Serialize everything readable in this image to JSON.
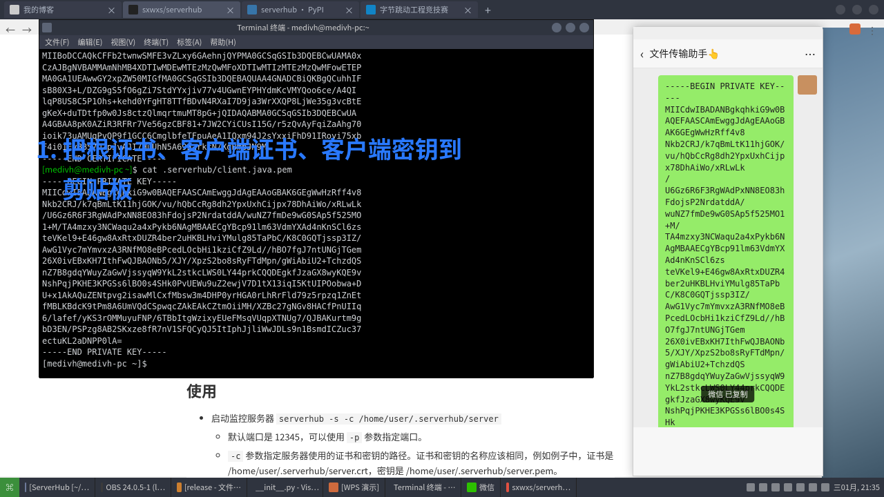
{
  "browser": {
    "tabs": [
      {
        "title": "我的博客"
      },
      {
        "title": "sxwxs/serverhub"
      },
      {
        "title": "serverhub · PyPI"
      },
      {
        "title": "字节跳动工程竞技赛"
      }
    ],
    "new_tab_label": "+"
  },
  "terminal": {
    "title": "Terminal 终端 - medivh@medivh-pc:~",
    "menus": [
      "文件(F)",
      "编辑(E)",
      "视图(V)",
      "终端(T)",
      "标签(A)",
      "帮助(H)"
    ],
    "lines": [
      "MIIBoDCCAQkCFFb2twnwSMFE3vZLxy6GAehnjQYPMA0GCSqGSIb3DQEBCwUAMA0x",
      "CzAJBgNVBAMMAmNhMB4XDTIwMDEwMTEzMzQwMFoXDTIwMTIzMTEzMzQwMFowETEP",
      "MA0GA1UEAwwGY2xpZW50MIGfMA0GCSqGSIb3DQEBAQUAA4GNADCBiQKBgQCuhhIF",
      "sB80X3+L/DZG9gS5fO6gZi7StdYYxjiv77v4UGwnEYPHYdmKcVMYQoo6ce/A4QI",
      "lqP8US8C5P1Ohs+kehd0YFgHT8TTfBDvN4RXaI7D9ja3WrXXQP8LjWe35g3vcBtE",
      "gKeX+duTDtfp0w0Js8ctzQlmqrtmuMT8pG+jQIDAQABMA0GCSqGSIb3DQEBCwUA",
      "A4GBAA8pK0AZiR3RFRr7Ve56gzCBF81+7JW2CYiCUsI15G/r5zQvAyFqiZaAhg70",
      "ioik73uAMUqPvQP9f1GCC6CmglbfeTFpuAeA1IQxm94J2sYxxiFhD91IRoyi75xb",
      "F4i01EvBB57UZpJvAJI7HuUhN5A695arkfN/XgBmbJN9M",
      "-----END CERTIFICATE-----",
      "[medivh@medivh-pc ~]$ cat .serverhub/client.java.pem",
      "-----BEGIN PRIVATE KEY-----",
      "MIICdwIBADANBgkqhkiG9w0BAQEFAASCAmEwggJdAgEAAoGBAK6GEgWwHzRff4v8",
      "Nkb2CRJ/k7qBmLtK11hjGOK/vu/hQbCcRg8dh2YpxUxhCijpx78DhAiWo/xRLwLk",
      "/U6Gz6R6F3RgWAdPxNN8EO83hFdojsP2NrdatddA/wuNZ7fmDe9wG0SAp5f525MO",
      "1+M/TA4mzxy3NCWaqu2a4xPykb6NAgMBAAECgYBcp91lm63VdmYXAd4nKnSCl6zs",
      "teVKel9+E46gw8AxRtxDUZR4ber2uHKBLHviYMulg85TaPbC/K8C0GQTjssp3IZ/",
      "AwG1Vyc7mYmvxzA3RNfMO8eBPcedLOcbHi1kziCfZ9Ld//hBO7fgJ7ntUNGjTGem",
      "26X0ivEBxKH7IthFwQJBAONb5/XJY/XpzS2bo8sRyFTdMpn/gWiAbiU2+TchzdQS",
      "nZ7B8gdqYWuyZaGwVjssyqW9YkL2stkcLWS0LY44prkCQQDEgkfJzaGX8wyKQE9v",
      "NshPqjPKHE3KPGSs6lBO0s4SHk0PvUEWu9uZ2ewjV7D1tX13iqI5KtUIPOobwa+D",
      "U+x1AkAQuZENtpvg2isawMlCxfMbsw3m4DHP0yrHGA0rLhRrFld79z5rpzq1ZnEt",
      "fMBLKBdcK9tPm8A6UmVQdCSpwqcZAkEAkCZtmOiiMH/XZBc27gNGv8HACfPnUIIq",
      "6/lafef/yKS3rOMMuyuFNP/6TBbItgWzixyEUeFMsqVUqpXTNUg7/QJBAKurtm9g",
      "bD3EN/PSPzg8AB2SKxze8fR7nV1SFQCyQJ5ItIphJjliWwJDLs9n1BsmdICZuc37",
      "ectuKL2aDNPP0lA=",
      "-----END PRIVATE KEY-----",
      "[medivh@medivh-pc ~]$ "
    ],
    "prompt_index_1": 10,
    "prompt_index_2": 28
  },
  "watermark": {
    "line1": "1. 把根证书、客户端证书、客户端密钥到",
    "line2": "剪贴板"
  },
  "page": {
    "heading": "使用",
    "item1_pre": "启动监控服务器 ",
    "item1_code": "serverhub -s -c /home/user/.serverhub/server",
    "sub1_a": "默认端口是 12345，可以使用 ",
    "sub1_code": "-p",
    "sub1_b": " 参数指定端口。",
    "sub2_code": "-c",
    "sub2_a": " 参数指定服务器使用的证书和密钥的路径。证书和密钥的名称应该相同，例如例子中，证书是 /home/user/.serverhub/server.crt，密钥是 /home/user/.serverhub/server.pem。"
  },
  "wechat": {
    "title": "文件传输助手",
    "emoji": "👆",
    "message": "-----BEGIN PRIVATE KEY-----\nMIICdwIBADANBgkqhkiG9w0BAQEFAASCAmEwggJdAgEAAoGBAK6GEgWwHzRff4v8\nNkb2CRJ/k7qBmLtK11hjGOK/vu/hQbCcRg8dh2YpxUxhCijpx78DhAiWo/xRLwLk\n/\nU6Gz6R6F3RgWAdPxNN8EO83hFdojsP2NrdatddA/\nwuNZ7fmDe9wG0SAp5f525MO1+M/\nTA4mzxy3NCWaqu2a4xPykb6NAgMBAAECgYBcp91lm63VdmYXAd4nKnSCl6zs\nteVKel9+E46gw8AxRtxDUZR4ber2uHKBLHviYMulg85TaPbC/K8C0GQTjssp3IZ/\nAwG1Vyc7mYmvxzA3RNfMO8eBPcedLOcbHi1kziCfZ9Ld//hBO7fgJ7ntUNGjTGem\n26X0ivEBxKH7IthFwQJBAONb5/XJY/XpzS2bo8sRyFTdMpn/gWiAbiU2+TchzdQS\nnZ7B8gdqYWuyZaGwVjssyqW9YkL2stkcLWS0LY44prkCQQDEgkfJzaGX8wyKQE9v\nNshPqjPKHE3KPGSs6lBO0s4SHk",
    "toast": "微信  已复制"
  },
  "taskbar": {
    "apps": [
      "[ServerHub [~/…",
      "OBS 24.0.5-1 (l…",
      "[release - 文件…",
      "__init__.py - Vis…",
      "[WPS 演示]",
      "Terminal 终端 - …",
      "微信",
      "sxwxs/serverh…"
    ],
    "clock": "三01月, 21:35"
  }
}
